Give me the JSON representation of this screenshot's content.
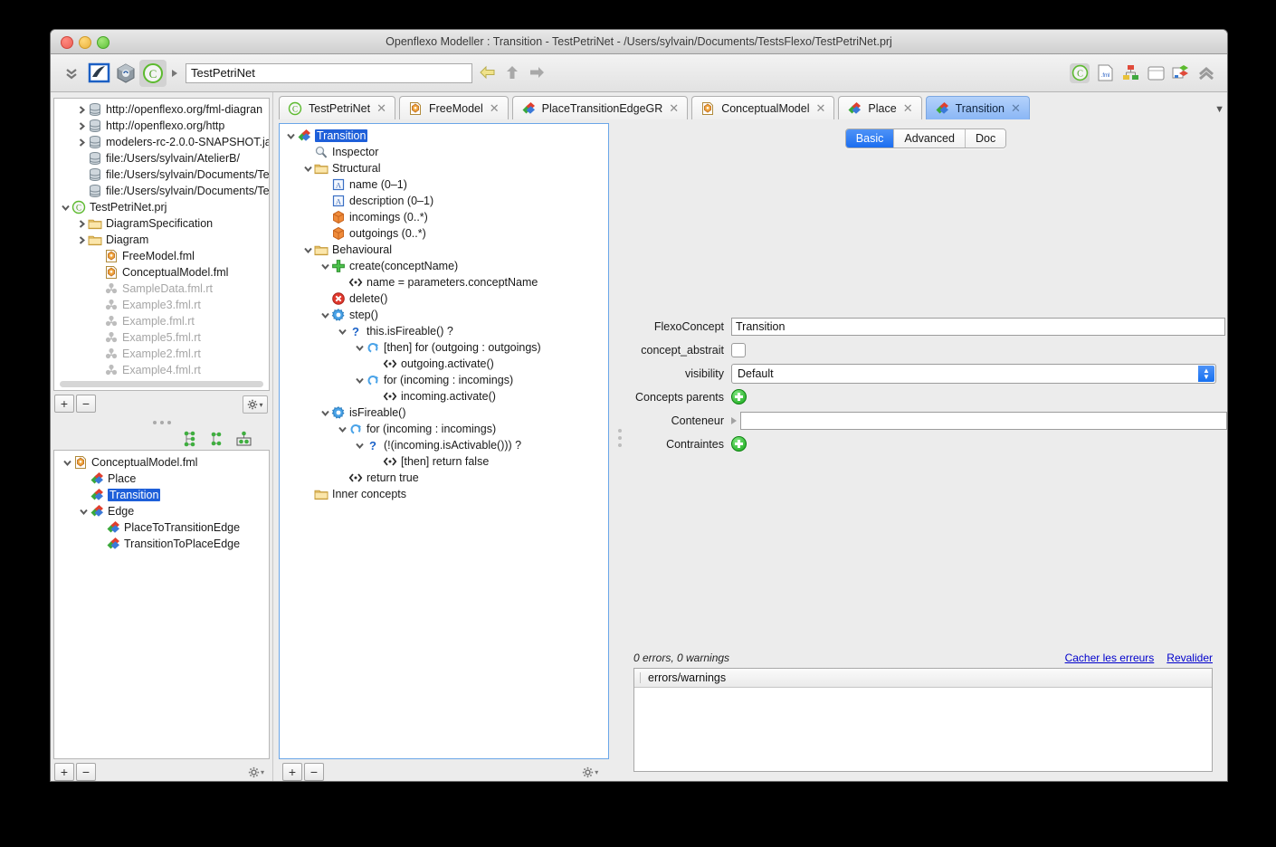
{
  "window": {
    "title": "Openflexo Modeller : Transition - TestPetriNet - /Users/sylvain/Documents/TestsFlexo/TestPetriNet.prj"
  },
  "toolbar": {
    "address_value": "TestPetriNet",
    "icons_left": [
      "chevrons-down-icon",
      "flexo-blue-icon",
      "flexo-cube-icon",
      "openflexo-c-icon"
    ],
    "path_arrow": "play-triangle-icon",
    "nav": [
      "back-arrow-icon",
      "up-arrow-icon",
      "forward-arrow-icon"
    ],
    "icons_right": [
      "openflexo-c-icon",
      "fml-doc-icon",
      "hierarchy-icon",
      "window-icon",
      "diagram-icon",
      "collapse-up-icon"
    ]
  },
  "browser": {
    "items": [
      {
        "label": "http://openflexo.org/fml-diagran",
        "icon": "database-icon",
        "twisty": "collapsed",
        "indent": 1,
        "dim": false
      },
      {
        "label": "http://openflexo.org/http",
        "icon": "database-icon",
        "twisty": "collapsed",
        "indent": 1,
        "dim": false
      },
      {
        "label": "modelers-rc-2.0.0-SNAPSHOT.ja",
        "icon": "database-icon",
        "twisty": "collapsed",
        "indent": 1,
        "dim": false
      },
      {
        "label": "file:/Users/sylvain/AtelierB/",
        "icon": "database-icon",
        "twisty": "none",
        "indent": 1,
        "dim": false
      },
      {
        "label": "file:/Users/sylvain/Documents/Te",
        "icon": "database-icon",
        "twisty": "none",
        "indent": 1,
        "dim": false
      },
      {
        "label": "file:/Users/sylvain/Documents/Te",
        "icon": "database-icon",
        "twisty": "none",
        "indent": 1,
        "dim": false
      },
      {
        "label": "TestPetriNet.prj",
        "icon": "openflexo-c-icon",
        "twisty": "expanded",
        "indent": 0,
        "dim": false
      },
      {
        "label": "DiagramSpecification",
        "icon": "folder-icon",
        "twisty": "collapsed",
        "indent": 1,
        "dim": false
      },
      {
        "label": "Diagram",
        "icon": "folder-icon",
        "twisty": "collapsed",
        "indent": 1,
        "dim": false
      },
      {
        "label": "FreeModel.fml",
        "icon": "fml-icon",
        "twisty": "none",
        "indent": 2,
        "dim": false
      },
      {
        "label": "ConceptualModel.fml",
        "icon": "fml-icon",
        "twisty": "none",
        "indent": 2,
        "dim": false
      },
      {
        "label": "SampleData.fml.rt",
        "icon": "rt-icon",
        "twisty": "none",
        "indent": 2,
        "dim": true
      },
      {
        "label": "Example3.fml.rt",
        "icon": "rt-icon",
        "twisty": "none",
        "indent": 2,
        "dim": true
      },
      {
        "label": "Example.fml.rt",
        "icon": "rt-icon",
        "twisty": "none",
        "indent": 2,
        "dim": true
      },
      {
        "label": "Example5.fml.rt",
        "icon": "rt-icon",
        "twisty": "none",
        "indent": 2,
        "dim": true
      },
      {
        "label": "Example2.fml.rt",
        "icon": "rt-icon",
        "twisty": "none",
        "indent": 2,
        "dim": true
      },
      {
        "label": "Example4.fml.rt",
        "icon": "rt-icon",
        "twisty": "none",
        "indent": 2,
        "dim": true
      }
    ],
    "toolbar": {
      "add": "+",
      "remove": "−",
      "settings": "gear-icon"
    }
  },
  "conceptual": {
    "view_icons": [
      "tree-view-icon",
      "flat-view-icon",
      "grid-view-icon"
    ],
    "items": [
      {
        "label": "ConceptualModel.fml",
        "icon": "fml-icon",
        "twisty": "expanded",
        "indent": 0,
        "selected": false
      },
      {
        "label": "Place",
        "icon": "flexo-concept-icon",
        "twisty": "none",
        "indent": 1,
        "selected": false
      },
      {
        "label": "Transition",
        "icon": "flexo-concept-icon",
        "twisty": "none",
        "indent": 1,
        "selected": true
      },
      {
        "label": "Edge",
        "icon": "flexo-concept-icon",
        "twisty": "expanded",
        "indent": 1,
        "selected": false
      },
      {
        "label": "PlaceToTransitionEdge",
        "icon": "flexo-concept-icon",
        "twisty": "none",
        "indent": 2,
        "selected": false
      },
      {
        "label": "TransitionToPlaceEdge",
        "icon": "flexo-concept-icon",
        "twisty": "none",
        "indent": 2,
        "selected": false
      }
    ],
    "toolbar": {
      "add": "+",
      "remove": "−",
      "settings": "gear-icon"
    }
  },
  "doc_tabs": [
    {
      "label": "TestPetriNet",
      "icon": "openflexo-c-icon",
      "active": false,
      "close": "✕"
    },
    {
      "label": "FreeModel",
      "icon": "fml-icon",
      "active": false,
      "close": "✕"
    },
    {
      "label": "PlaceTransitionEdgeGR",
      "icon": "flexo-concept-icon",
      "active": false,
      "close": "✕"
    },
    {
      "label": "ConceptualModel",
      "icon": "fml-icon",
      "active": false,
      "close": "✕"
    },
    {
      "label": "Place",
      "icon": "flexo-concept-icon",
      "active": false,
      "close": "✕"
    },
    {
      "label": "Transition",
      "icon": "flexo-concept-icon",
      "active": true,
      "close": "✕"
    }
  ],
  "tab_overflow_icon": "chevron-down-icon",
  "fml_tree": [
    {
      "label": "Transition",
      "icon": "flexo-concept-icon",
      "twisty": "expanded",
      "indent": 0,
      "selected": true
    },
    {
      "label": "Inspector",
      "icon": "magnifier-icon",
      "twisty": "none",
      "indent": 1,
      "selected": false
    },
    {
      "label": "Structural",
      "icon": "folder-icon",
      "twisty": "expanded",
      "indent": 1,
      "selected": false
    },
    {
      "label": "name (0–1)",
      "icon": "string-attr-icon",
      "twisty": "none",
      "indent": 2,
      "selected": false
    },
    {
      "label": "description (0–1)",
      "icon": "string-attr-icon",
      "twisty": "none",
      "indent": 2,
      "selected": false
    },
    {
      "label": "incomings (0..*)",
      "icon": "orange-box-icon",
      "twisty": "none",
      "indent": 2,
      "selected": false
    },
    {
      "label": "outgoings (0..*)",
      "icon": "orange-box-icon",
      "twisty": "none",
      "indent": 2,
      "selected": false
    },
    {
      "label": "Behavioural",
      "icon": "folder-icon",
      "twisty": "expanded",
      "indent": 1,
      "selected": false
    },
    {
      "label": "create(conceptName)",
      "icon": "green-plus-icon",
      "twisty": "expanded",
      "indent": 2,
      "selected": false
    },
    {
      "label": "name = parameters.conceptName",
      "icon": "expression-icon",
      "twisty": "none",
      "indent": 3,
      "selected": false
    },
    {
      "label": "delete()",
      "icon": "red-delete-icon",
      "twisty": "none",
      "indent": 2,
      "selected": false
    },
    {
      "label": "step()",
      "icon": "blue-gear-icon",
      "twisty": "expanded",
      "indent": 2,
      "selected": false
    },
    {
      "label": "this.isFireable() ?",
      "icon": "question-icon",
      "twisty": "expanded",
      "indent": 3,
      "selected": false
    },
    {
      "label": "[then]  for (outgoing : outgoings)",
      "icon": "loop-icon",
      "twisty": "expanded",
      "indent": 4,
      "selected": false
    },
    {
      "label": "outgoing.activate()",
      "icon": "expression-icon",
      "twisty": "none",
      "indent": 5,
      "selected": false
    },
    {
      "label": "for (incoming : incomings)",
      "icon": "loop-icon",
      "twisty": "expanded",
      "indent": 4,
      "selected": false
    },
    {
      "label": "incoming.activate()",
      "icon": "expression-icon",
      "twisty": "none",
      "indent": 5,
      "selected": false
    },
    {
      "label": "isFireable()",
      "icon": "blue-gear-icon",
      "twisty": "expanded",
      "indent": 2,
      "selected": false
    },
    {
      "label": "for (incoming : incomings)",
      "icon": "loop-icon",
      "twisty": "expanded",
      "indent": 3,
      "selected": false
    },
    {
      "label": "(!(incoming.isActivable())) ?",
      "icon": "question-icon",
      "twisty": "expanded",
      "indent": 4,
      "selected": false
    },
    {
      "label": "[then] return false",
      "icon": "expression-icon",
      "twisty": "none",
      "indent": 5,
      "selected": false
    },
    {
      "label": "return true",
      "icon": "expression-icon",
      "twisty": "none",
      "indent": 3,
      "selected": false
    },
    {
      "label": "Inner concepts",
      "icon": "folder-icon",
      "twisty": "none",
      "indent": 1,
      "selected": false
    }
  ],
  "fml_toolbar": {
    "add": "+",
    "remove": "−",
    "settings": "gear-icon"
  },
  "inspector": {
    "segments": [
      {
        "label": "Basic",
        "active": true
      },
      {
        "label": "Advanced",
        "active": false
      },
      {
        "label": "Doc",
        "active": false
      }
    ],
    "fields": [
      {
        "label": "FlexoConcept",
        "type": "text",
        "value": "Transition"
      },
      {
        "label": "concept_abstrait",
        "type": "checkbox",
        "checked": false
      },
      {
        "label": "visibility",
        "type": "combo",
        "value": "Default"
      },
      {
        "label": "Concepts parents",
        "type": "plus"
      },
      {
        "label": "Conteneur",
        "type": "text-with-arrow",
        "value": ""
      },
      {
        "label": "Contraintes",
        "type": "plus"
      }
    ]
  },
  "errors": {
    "summary": "0 errors, 0 warnings",
    "links": [
      "Cacher les erreurs",
      "Revalider"
    ],
    "column_header": "errors/warnings",
    "rows": []
  },
  "colors": {
    "accent_blue": "#1e5fd9",
    "selected_tab": "#8ab6f5",
    "link": "#0000cc",
    "green": "#17a81a",
    "window_bg": "#ececec"
  }
}
